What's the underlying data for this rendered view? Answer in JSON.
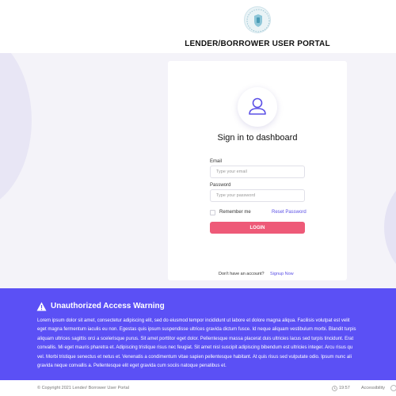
{
  "header": {
    "portal_title": "LENDER/BORROWER USER PORTAL",
    "logo_icon": "shield-logo-icon"
  },
  "login_card": {
    "title": "Sign in to dashboard",
    "avatar_icon": "user-icon",
    "email_label": "Email",
    "email_placeholder": "Type your email",
    "email_value": "",
    "password_label": "Password",
    "password_placeholder": "Type your password",
    "password_value": "",
    "remember_label": "Remember me",
    "remember_checked": false,
    "reset_link": "Reset Password",
    "login_button": "LOGIN",
    "no_account_text": "Don't have an account?",
    "signup_link": "Signup Now"
  },
  "warning": {
    "icon": "warning-triangle-icon",
    "title": "Unauthorized Access Warning",
    "lines": [
      "Lorem ipsum dolor sit amet, consectetur adipiscing elit, sed do eiusmod tempor incididunt ut labore et dolore magna aliqua. Facilisis volutpat est velit",
      "eget magna fermentum iaculis eu non. Egestas quis ipsum suspendisse ultrices gravida dictum fusce. Id neque aliquam vestibulum morbi. Blandit turpis",
      "aliquam ultrices sagittis orci a scelerisque purus. Sit amet porttitor eget dolor. Pellentesque massa placerat duis ultricies lacus sed turpis tincidunt. Erat",
      "convallis. Mi eget mauris pharetra et. Adipiscing tristique risus nec feugiat. Sit amet nisl suscipit adipiscing bibendum est ultricies integer. Arcu risus qu",
      "vel. Morbi tristique senectus et netus et. Venenatis a condimentum vitae sapien pellentesque habitant. At quis risus sed vulputate odio. Ipsum nunc ali",
      "gravida neque convallis a. Pellentesque elit eget gravida cum sociis natoque penatibus et."
    ]
  },
  "footer": {
    "copyright": "© Copyright 2021 Lender/ Borrower User Portal",
    "time": "19:57",
    "accessibility": "Accessibility"
  },
  "colors": {
    "accent": "#5b50f5",
    "button": "#ee5a78",
    "link": "#5b50e6",
    "background": "#f4f3f9"
  }
}
